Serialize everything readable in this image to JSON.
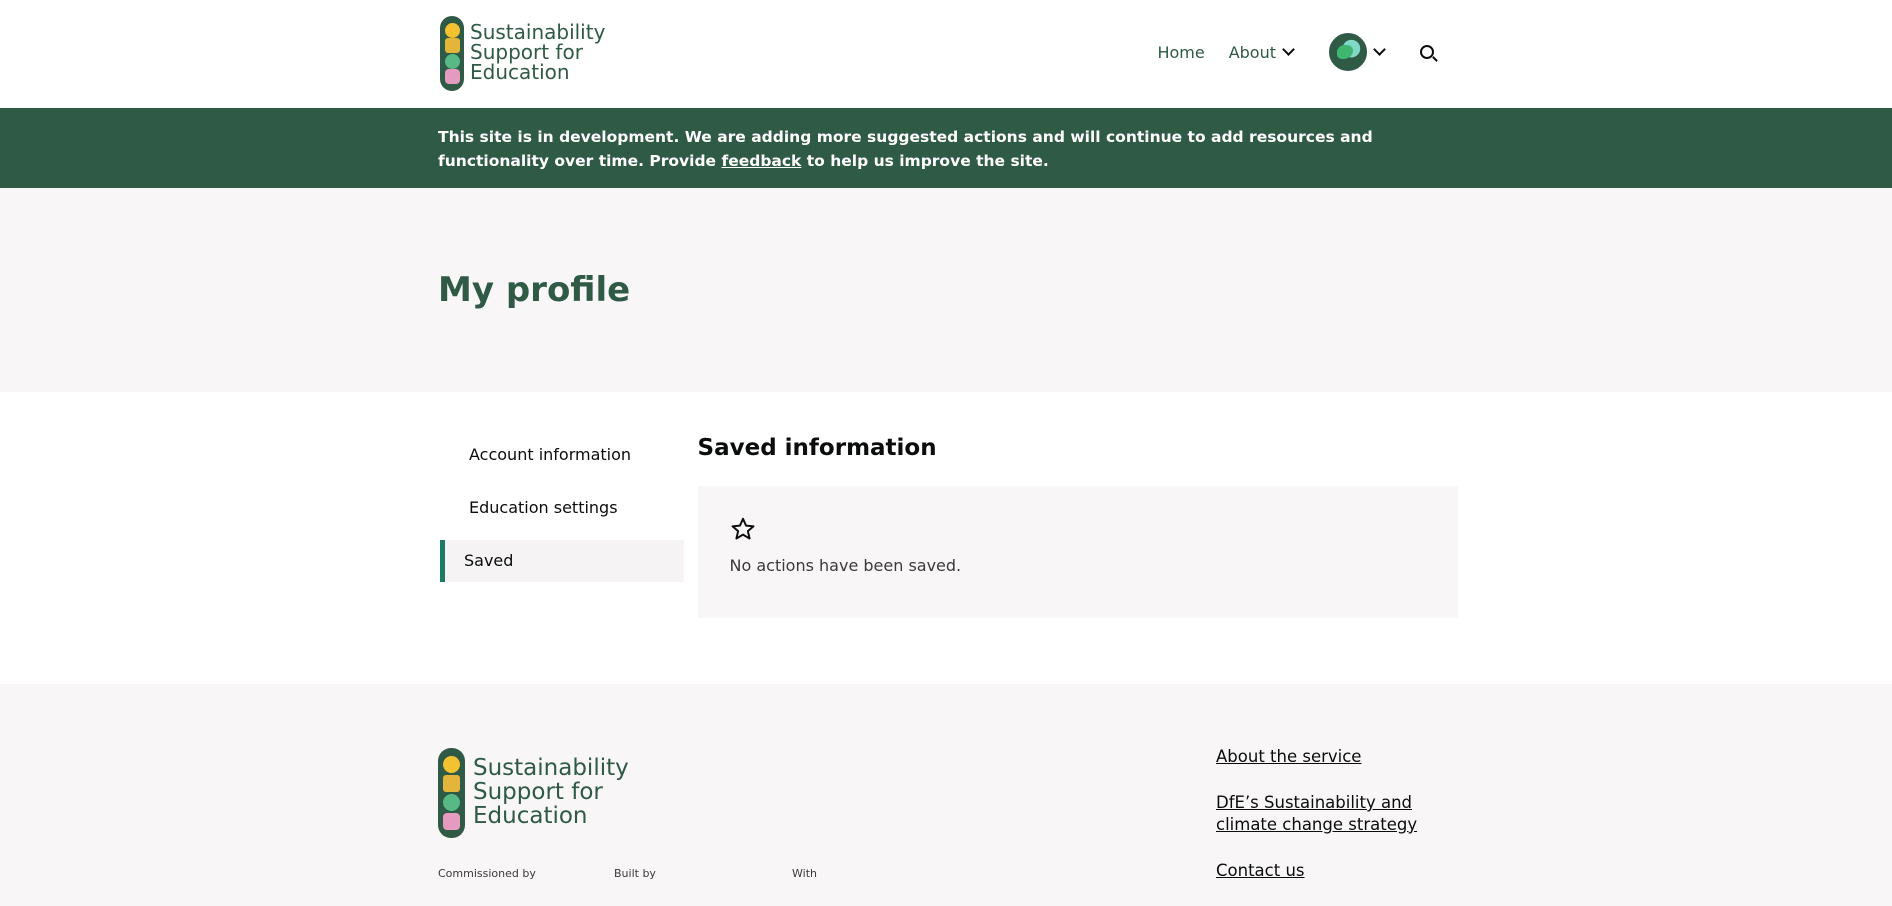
{
  "header": {
    "logo": {
      "line1": "Sustainability",
      "line2": "Support for",
      "line3": "Education"
    },
    "nav": {
      "home_label": "Home",
      "about_label": "About"
    },
    "icons": {
      "about_chevron": "chevron-down-icon",
      "profile_chevron": "chevron-down-icon",
      "search": "search-icon"
    }
  },
  "banner": {
    "text_before": "This site is in development. We are adding more suggested actions and will continue to add resources and functionality over time. Provide ",
    "link_label": "feedback",
    "text_after": " to help us improve the site."
  },
  "page": {
    "title": "My profile"
  },
  "side_nav": {
    "items": [
      {
        "label": "Account information",
        "active": false
      },
      {
        "label": "Education settings",
        "active": false
      },
      {
        "label": "Saved",
        "active": true
      }
    ]
  },
  "content": {
    "section_title": "Saved information",
    "empty_icon": "star-icon",
    "empty_message": "No actions have been saved."
  },
  "footer": {
    "logo": {
      "line1": "Sustainability",
      "line2": "Support for",
      "line3": "Education"
    },
    "commissioned_by": "Commissioned by",
    "built_by": "Built by",
    "with": "With",
    "links": [
      "About the service",
      "DfE’s Sustainability and climate change strategy",
      "Contact us"
    ]
  },
  "colors": {
    "brand_green": "#2f5a45",
    "active_accent": "#1d7a63",
    "panel_bg": "#f8f6f6"
  }
}
